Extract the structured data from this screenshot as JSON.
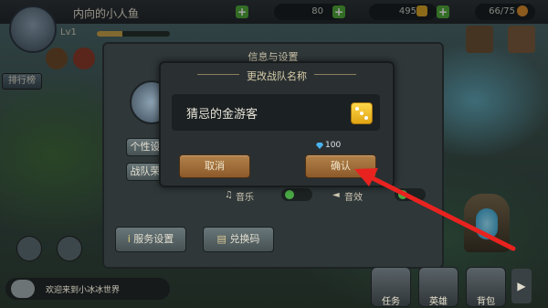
{
  "hud": {
    "player_name": "内向的小人鱼",
    "level": "Lv1",
    "xp_fraction": 0.35,
    "resources": [
      {
        "value": "80"
      },
      {
        "value": "495"
      },
      {
        "value": "66/75"
      }
    ]
  },
  "left_menu": {
    "ranking_label": "排行榜"
  },
  "settings_panel": {
    "title": "信息与设置",
    "personal_label": "个性设",
    "team_label": "战队荣",
    "music_label": "音乐",
    "sound_label": "音效",
    "server_button": "服务设置",
    "redeem_button": "兑换码"
  },
  "rename_dialog": {
    "title": "更改战队名称",
    "team_name": "猜忌的金游客",
    "cost": "100",
    "cancel_label": "取消",
    "confirm_label": "确认"
  },
  "bottom_bar": {
    "task_label": "任务",
    "hero_label": "英雄",
    "bag_label": "背包"
  },
  "chat": {
    "text": "欢迎来到小冰冰世界"
  },
  "colors": {
    "accent_arrow": "#e8231f",
    "button_brown": "#a06f3a",
    "gem_blue": "#49b3f1"
  }
}
